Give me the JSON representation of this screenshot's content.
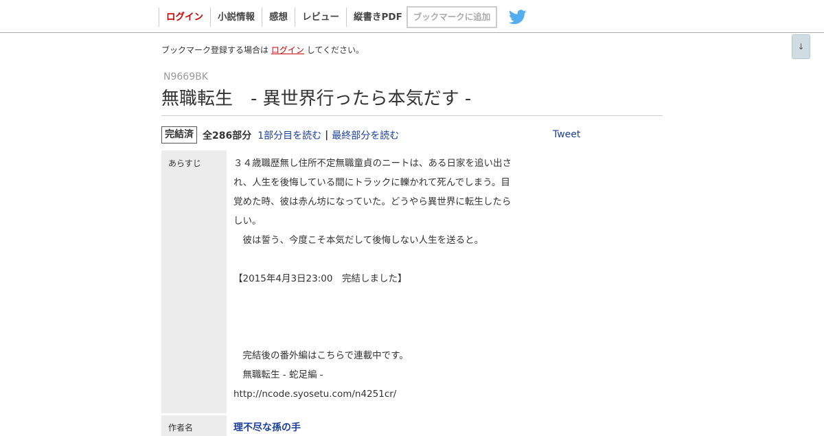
{
  "nav": {
    "items": [
      "ログイン",
      "小説情報",
      "感想",
      "レビュー",
      "縦書きPDF"
    ],
    "bookmark_add_label": "ブックマークに追加",
    "twitter_icon": "twitter-bird-icon",
    "accent_color": "#cc0000",
    "twitter_color": "#55acee"
  },
  "scroll_button": "↓",
  "notice": {
    "prefix": "ブックマーク登録する場合は",
    "link": "ログイン",
    "suffix": "してください。"
  },
  "novel": {
    "ncode": "N9669BK",
    "title": "無職転生　- 異世界行ったら本気だす -",
    "status": "完結済",
    "parts": "全286部分",
    "read_first": "1部分目を読む",
    "separator": "|",
    "read_last": "最終部分を読む",
    "tweet": "Tweet"
  },
  "info": {
    "summary_label": "あらすじ",
    "summary_lines": [
      "３４歳職歴無し住所不定無職童貞のニートは、ある日家を追い出さ",
      "れ、人生を後悔している間にトラックに轢かれて死んでしまう。目",
      "覚めた時、彼は赤ん坊になっていた。どうやら異世界に転生したら",
      "しい。",
      "　彼は誓う、今度こそ本気だして後悔しない人生を送ると。",
      "",
      "【2015年4月3日23:00　完結しました】",
      "",
      "",
      "",
      "　完結後の番外編はこちらで連載中です。",
      "　無職転生 - 蛇足編 -",
      "http://ncode.syosetu.com/n4251cr/"
    ],
    "author_label": "作者名",
    "author_name": "理不尽な孫の手"
  }
}
